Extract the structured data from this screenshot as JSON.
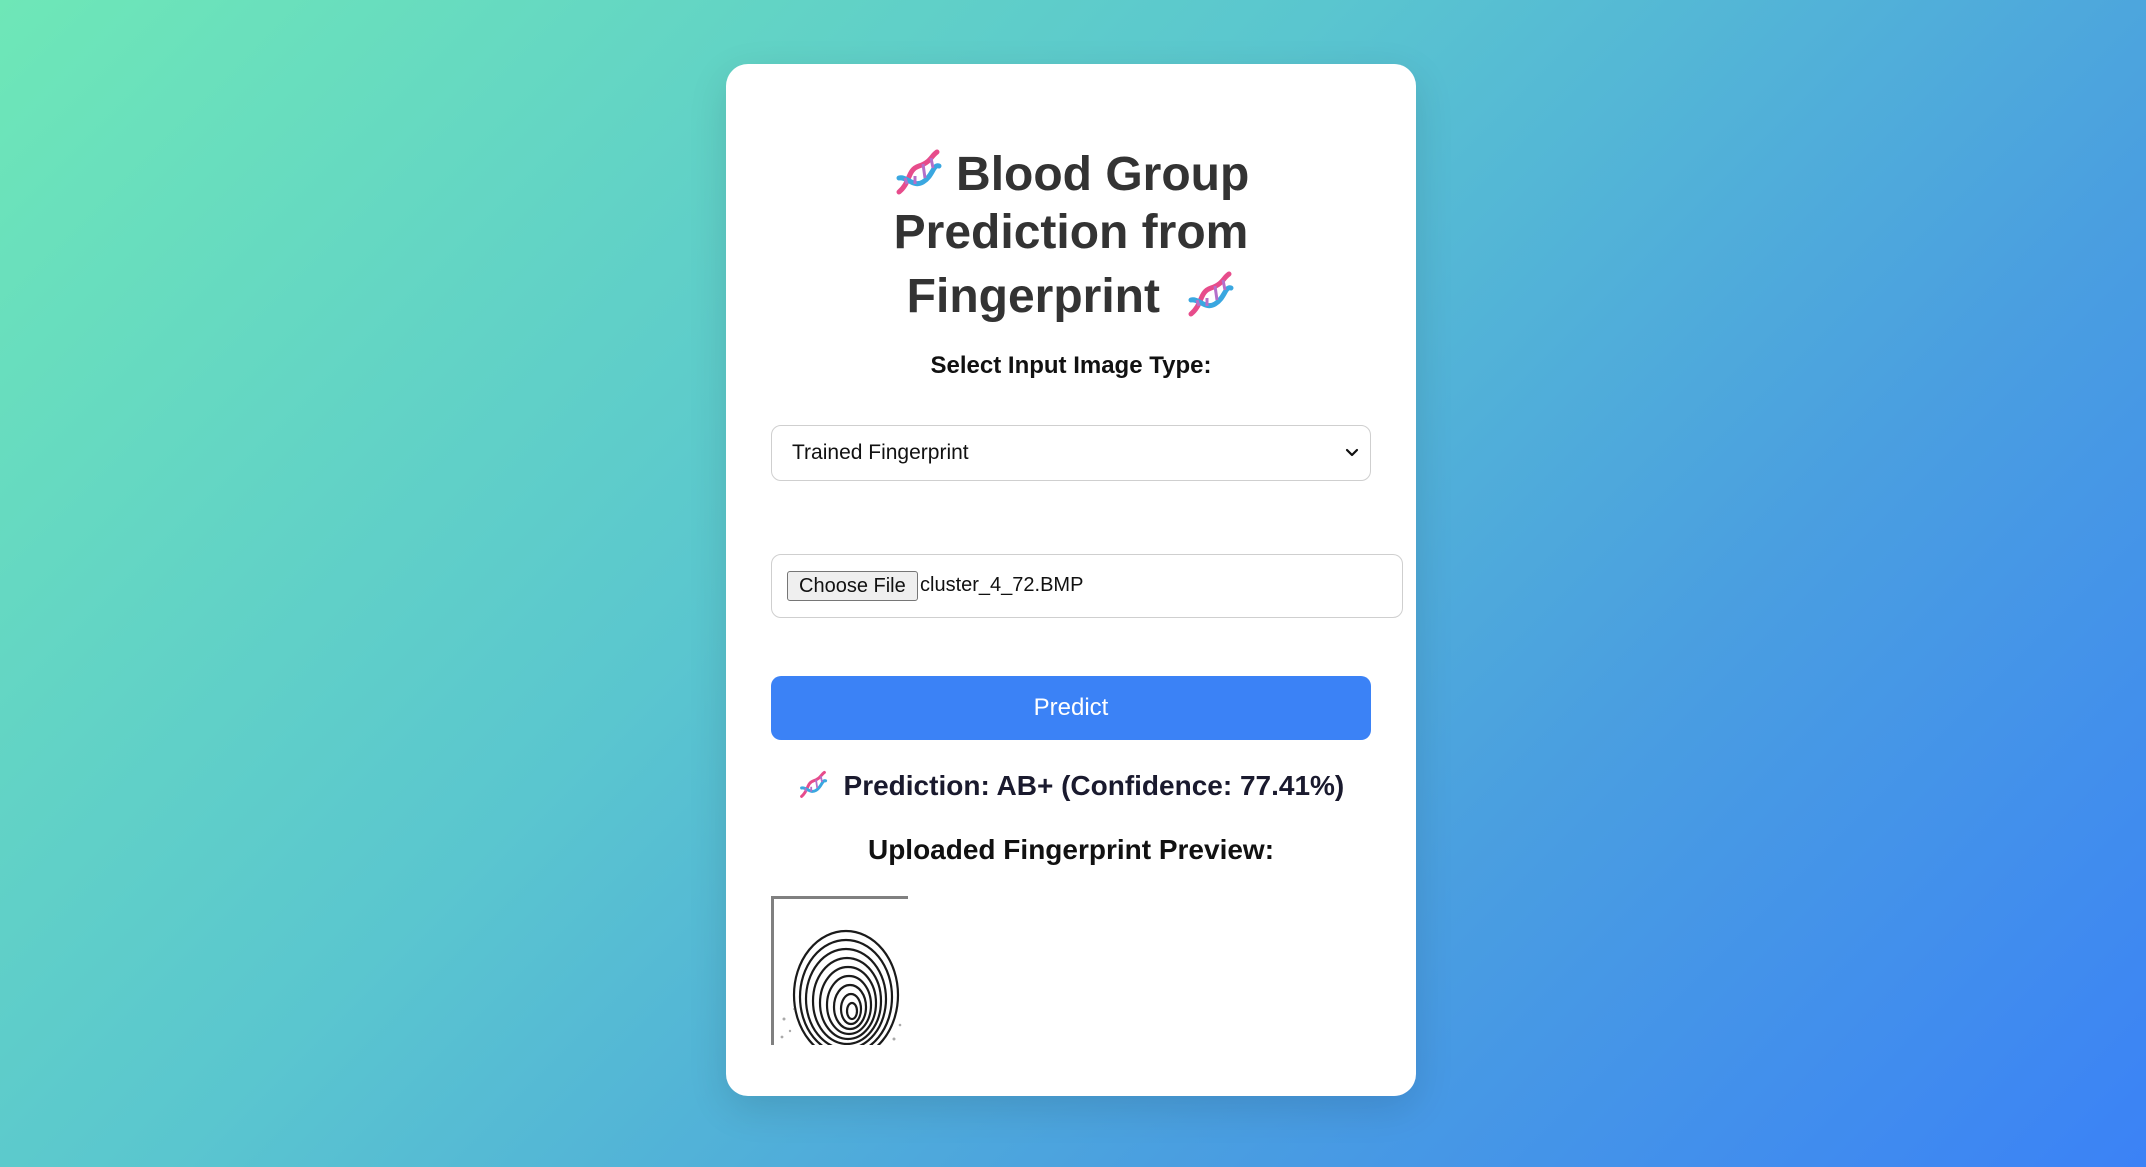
{
  "header": {
    "title_line1": "Blood Group",
    "title_line2": "Prediction from",
    "title_line3": "Fingerprint",
    "title_icon": "dna-icon"
  },
  "form": {
    "select_label": "Select Input Image Type:",
    "select_value": "Trained Fingerprint",
    "file_button_label": "Choose File",
    "file_name": "cluster_4_72.BMP",
    "predict_label": "Predict"
  },
  "result": {
    "prediction_text": "Prediction: AB+ (Confidence: 77.41%)",
    "preview_label": "Uploaded Fingerprint Preview:"
  },
  "colors": {
    "accent": "#3b82f6",
    "bg_start": "#6ee7b7",
    "bg_end": "#3b82f6"
  }
}
